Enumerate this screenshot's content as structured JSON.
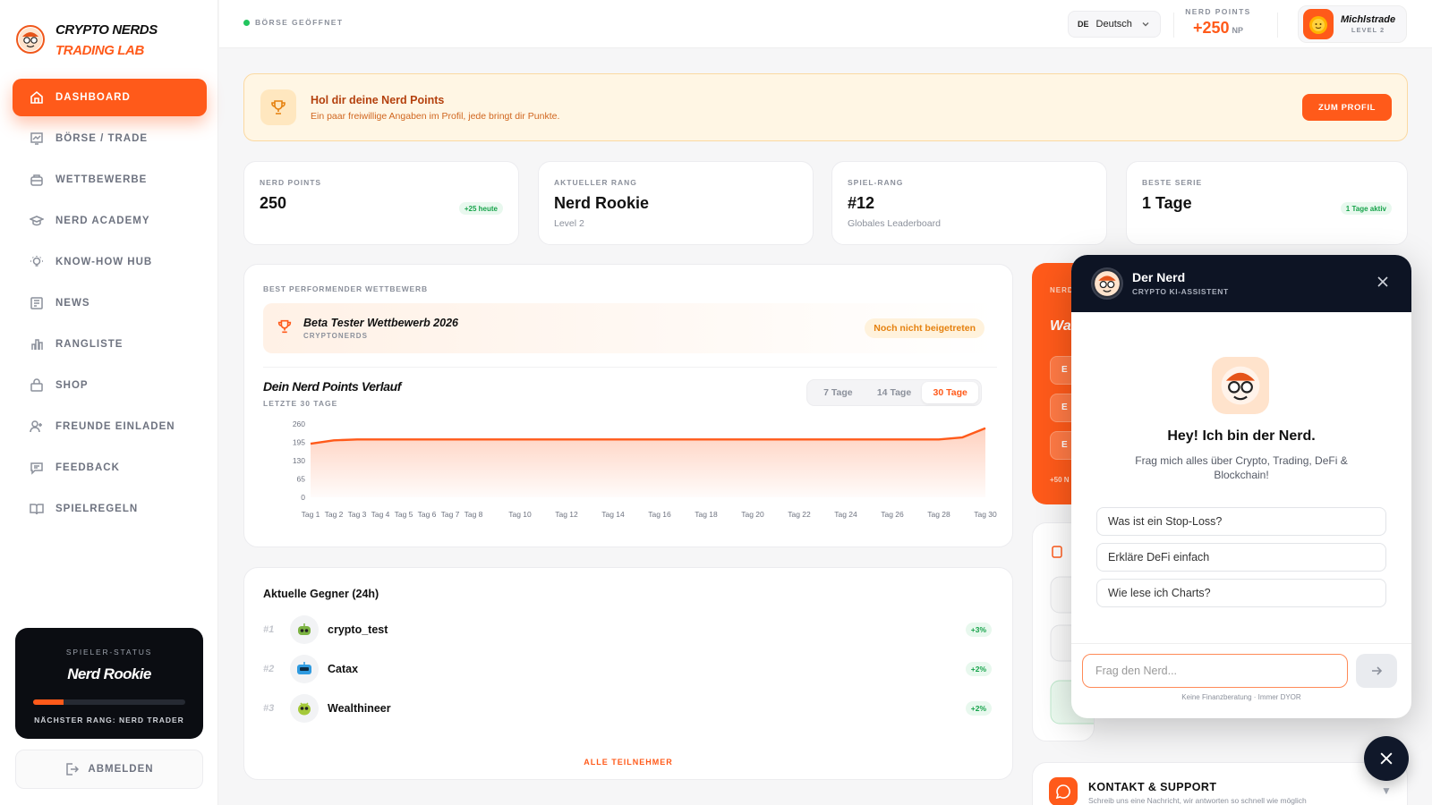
{
  "brand": {
    "line1": "CRYPTO NERDS",
    "line2": "TRADING LAB"
  },
  "nav": [
    {
      "label": "DASHBOARD",
      "icon": "home-icon",
      "active": true
    },
    {
      "label": "BÖRSE / TRADE",
      "icon": "chart-icon"
    },
    {
      "label": "WETTBEWERBE",
      "icon": "trophy-box-icon"
    },
    {
      "label": "NERD ACADEMY",
      "icon": "graduation-icon"
    },
    {
      "label": "KNOW-HOW HUB",
      "icon": "bulb-icon"
    },
    {
      "label": "NEWS",
      "icon": "newspaper-icon"
    },
    {
      "label": "RANGLISTE",
      "icon": "bar-chart-icon"
    },
    {
      "label": "SHOP",
      "icon": "bag-icon"
    },
    {
      "label": "FREUNDE EINLADEN",
      "icon": "user-plus-icon"
    },
    {
      "label": "FEEDBACK",
      "icon": "message-icon"
    },
    {
      "label": "SPIELREGELN",
      "icon": "book-icon"
    }
  ],
  "player_status": {
    "label": "SPIELER-STATUS",
    "rank": "Nerd Rookie",
    "progress": 0.2,
    "next": "NÄCHSTER RANG: NERD TRADER"
  },
  "logout": "ABMELDEN",
  "topbar": {
    "market": "BÖRSE GEÖFFNET",
    "lang_code": "DE",
    "lang": "Deutsch",
    "np_label": "NERD POINTS",
    "np_value": "+250",
    "np_unit": "NP",
    "user_name": "Michlstrade",
    "user_level": "LEVEL 2"
  },
  "promo": {
    "title": "Hol dir deine Nerd Points",
    "text": "Ein paar freiwillige Angaben im Profil, jede bringt dir Punkte.",
    "button": "ZUM PROFIL"
  },
  "stats": [
    {
      "label": "NERD POINTS",
      "value": "250",
      "badge": "+25 heute",
      "sub": ""
    },
    {
      "label": "AKTUELLER RANG",
      "value": "Nerd Rookie",
      "sub": "Level 2",
      "badge": ""
    },
    {
      "label": "SPIEL-RANG",
      "value": "#12",
      "sub": "Globales Leaderboard",
      "badge": ""
    },
    {
      "label": "BESTE SERIE",
      "value": "1 Tage",
      "badge": "1 Tage aktiv",
      "sub": ""
    }
  ],
  "competition": {
    "section": "BEST PERFORMENDER WETTBEWERB",
    "name": "Beta Tester Wettbewerb 2026",
    "org": "CRYPTONERDS",
    "status": "Noch nicht beigetreten"
  },
  "history": {
    "title": "Dein Nerd Points Verlauf",
    "sub": "LETZTE 30 TAGE",
    "ranges": [
      "7 Tage",
      "14 Tage",
      "30 Tage"
    ],
    "active_range": "30 Tage"
  },
  "chart_data": {
    "type": "area",
    "title": "Dein Nerd Points Verlauf",
    "x": [
      "Tag 1",
      "Tag 2",
      "Tag 3",
      "Tag 4",
      "Tag 5",
      "Tag 6",
      "Tag 7",
      "Tag 8",
      "Tag 9",
      "Tag 10",
      "Tag 11",
      "Tag 12",
      "Tag 13",
      "Tag 14",
      "Tag 15",
      "Tag 16",
      "Tag 17",
      "Tag 18",
      "Tag 19",
      "Tag 20",
      "Tag 21",
      "Tag 22",
      "Tag 23",
      "Tag 24",
      "Tag 25",
      "Tag 26",
      "Tag 27",
      "Tag 28",
      "Tag 29",
      "Tag 30"
    ],
    "xticks": [
      "Tag 1",
      "Tag 2",
      "Tag 3",
      "Tag 4",
      "Tag 5",
      "Tag 6",
      "Tag 7",
      "Tag 8",
      "Tag 10",
      "Tag 12",
      "Tag 14",
      "Tag 16",
      "Tag 18",
      "Tag 20",
      "Tag 22",
      "Tag 24",
      "Tag 26",
      "Tag 28",
      "Tag 30"
    ],
    "values": [
      190,
      202,
      205,
      205,
      205,
      205,
      205,
      205,
      205,
      205,
      205,
      205,
      205,
      205,
      205,
      205,
      205,
      205,
      205,
      205,
      205,
      205,
      205,
      205,
      205,
      205,
      205,
      205,
      212,
      245
    ],
    "yticks": [
      0,
      65,
      130,
      195,
      260
    ],
    "ylim": [
      0,
      260
    ],
    "color": "#ff5a1a",
    "grid": false
  },
  "opponents": {
    "title": "Aktuelle Gegner (24h)",
    "items": [
      {
        "rank": "#1",
        "name": "crypto_test",
        "change": "+3%",
        "color": "#9acd32"
      },
      {
        "rank": "#2",
        "name": "Catax",
        "change": "+2%",
        "color": "#2f9be0"
      },
      {
        "rank": "#3",
        "name": "Wealthineer",
        "change": "+2%",
        "color": "#9acd32"
      }
    ],
    "all": "ALLE TEILNEHMER"
  },
  "side": {
    "orange_label": "NERD",
    "orange_title": "Wa",
    "pill": "E",
    "bottom": "+50 N"
  },
  "support": {
    "title": "KONTAKT & SUPPORT",
    "text": "Schreib uns eine Nachricht, wir antworten so schnell wie möglich"
  },
  "chat": {
    "name": "Der Nerd",
    "sub": "CRYPTO KI-ASSISTENT",
    "hey": "Hey! Ich bin der Nerd.",
    "intro": "Frag mich alles über Crypto, Trading, DeFi & Blockchain!",
    "suggestions": [
      "Was ist ein Stop-Loss?",
      "Erkläre DeFi einfach",
      "Wie lese ich Charts?"
    ],
    "placeholder": "Frag den Nerd...",
    "disclaimer": "Keine Finanzberatung · Immer DYOR"
  },
  "colors": {
    "accent": "#ff5a1a",
    "dark": "#0d1424",
    "success": "#16a34a"
  }
}
